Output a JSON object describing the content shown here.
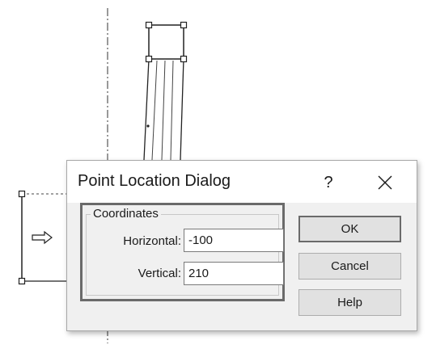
{
  "dialog": {
    "title": "Point Location Dialog",
    "help_glyph": "?",
    "close_icon": "close-icon",
    "coordinates_group": {
      "label": "Coordinates",
      "horizontal_label": "Horizontal:",
      "horizontal_value": "-100",
      "vertical_label": "Vertical:",
      "vertical_value": "210"
    },
    "buttons": {
      "ok": "OK",
      "cancel": "Cancel",
      "help": "Help"
    }
  },
  "background": {
    "arrow_icon": "arrow-right-outline-icon"
  }
}
